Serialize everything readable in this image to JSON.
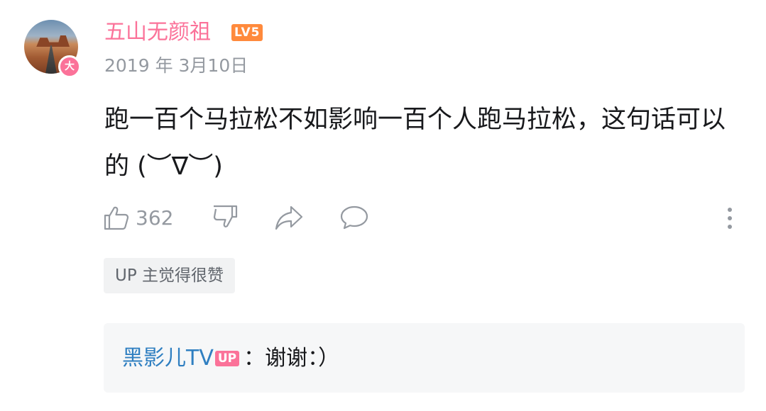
{
  "comment": {
    "username": "五山无颜祖",
    "level": "LV5",
    "vip_badge": "大",
    "date": "2019 年 3月10日",
    "text": "跑一百个马拉松不如影响一百个人跑马拉松，这句话可以的 (︶∇︶)",
    "like_count": "362",
    "up_tag": "UP 主觉得很赞"
  },
  "reply": {
    "username": "黑影儿TV",
    "badge": "UP",
    "text": "：谢谢：）"
  },
  "icons": {
    "like": "thumbs-up-icon",
    "dislike": "thumbs-down-icon",
    "share": "share-icon",
    "reply": "comment-bubble-icon",
    "more": "more-vertical-icon"
  },
  "colors": {
    "username": "#fb7299",
    "level_badge": "#ff8a3c",
    "reply_user": "#2f7fc1",
    "up_badge": "#fb7299"
  }
}
